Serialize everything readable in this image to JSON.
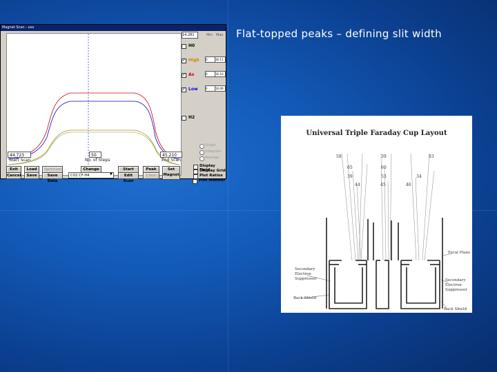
{
  "slide": {
    "title": "Flat-topped peaks – defining slit width"
  },
  "window": {
    "title": "Magnet Scan - xxx",
    "top_field": "14.281",
    "col_labels": [
      "Min",
      "Max"
    ],
    "channels": [
      {
        "label": "H0",
        "checked": false,
        "color": "#000000",
        "min": "",
        "max": ""
      },
      {
        "label": "High",
        "checked": true,
        "color": "#cc8800",
        "min": "0",
        "max": "3E-11"
      },
      {
        "label": "Ax",
        "checked": true,
        "color": "#cc0000",
        "min": "0",
        "max": "1E-10"
      },
      {
        "label": "Low",
        "checked": true,
        "color": "#0000cc",
        "min": "0",
        "max": "1E-09"
      },
      {
        "label": "H2",
        "checked": false,
        "color": "#000000",
        "min": "",
        "max": ""
      }
    ],
    "start_scan": {
      "value": "44.723",
      "label": "Start Scan"
    },
    "num_steps": {
      "value": "50",
      "label": "No. of Steps"
    },
    "end_scan": {
      "value": "45.210",
      "label": "End Scan"
    },
    "radios": [
      "Single",
      "Integrate",
      "Average"
    ],
    "buttons": {
      "exit": "Exit",
      "load": "Load",
      "optimize": "Optimize",
      "change": "Change",
      "start": "Start",
      "peak": "Peak",
      "set_magnet": "Set Magnet",
      "cancel": "Cancel",
      "save": "Save",
      "save_data": "Save Data",
      "edit_scan": "Edit Scan",
      "clear": "Clear"
    },
    "selected_peak": "CO2 CF-H4",
    "checkboxes": [
      "Display Field",
      "Display Grid",
      "Plot Ratios",
      "Plot Monitor"
    ]
  },
  "figure": {
    "title": "Universal Triple Faraday Cup Layout",
    "numbers": [
      "58",
      "39",
      "83",
      "65",
      "60",
      "39",
      "53",
      "34",
      "44",
      "45",
      "46"
    ],
    "labels": {
      "focal_plane": "Focal Plane",
      "secondary_left": "Secondary Electron Suppressor",
      "secondary_right": "Secondary Electron Suppressor",
      "back_shield_left": "Back Shield",
      "back_shield_right": "Back Shield"
    }
  },
  "colors": {
    "background": "#135ab8",
    "high": "#cc8800",
    "ax": "#cc0000",
    "low": "#0000cc"
  }
}
